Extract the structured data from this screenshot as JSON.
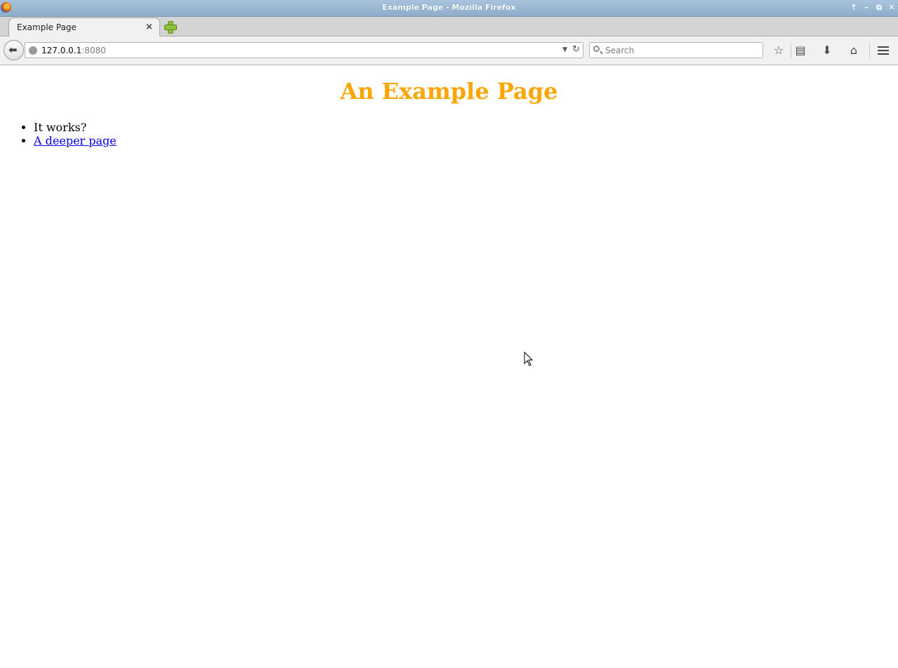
{
  "window": {
    "title": "Example Page - Mozilla Firefox",
    "controls": {
      "up": "↑",
      "minimize": "–",
      "maximize": "⧉",
      "close": "✕"
    }
  },
  "tabs": [
    {
      "label": "Example Page",
      "close": "×",
      "active": true
    }
  ],
  "navbar": {
    "url_host": "127.0.0.1",
    "url_port": ":8080",
    "search_placeholder": "Search",
    "icons": [
      "back-icon",
      "site-identity-icon",
      "url-dropdown-icon",
      "reload-icon",
      "search-icon",
      "bookmark-star-icon",
      "reading-list-icon",
      "downloads-icon",
      "home-icon",
      "menu-icon"
    ]
  },
  "page": {
    "heading": "An Example Page",
    "heading_color": "#ffa500",
    "items": [
      {
        "text": "It works?"
      },
      {
        "text": "A deeper page",
        "is_link": true
      }
    ]
  }
}
